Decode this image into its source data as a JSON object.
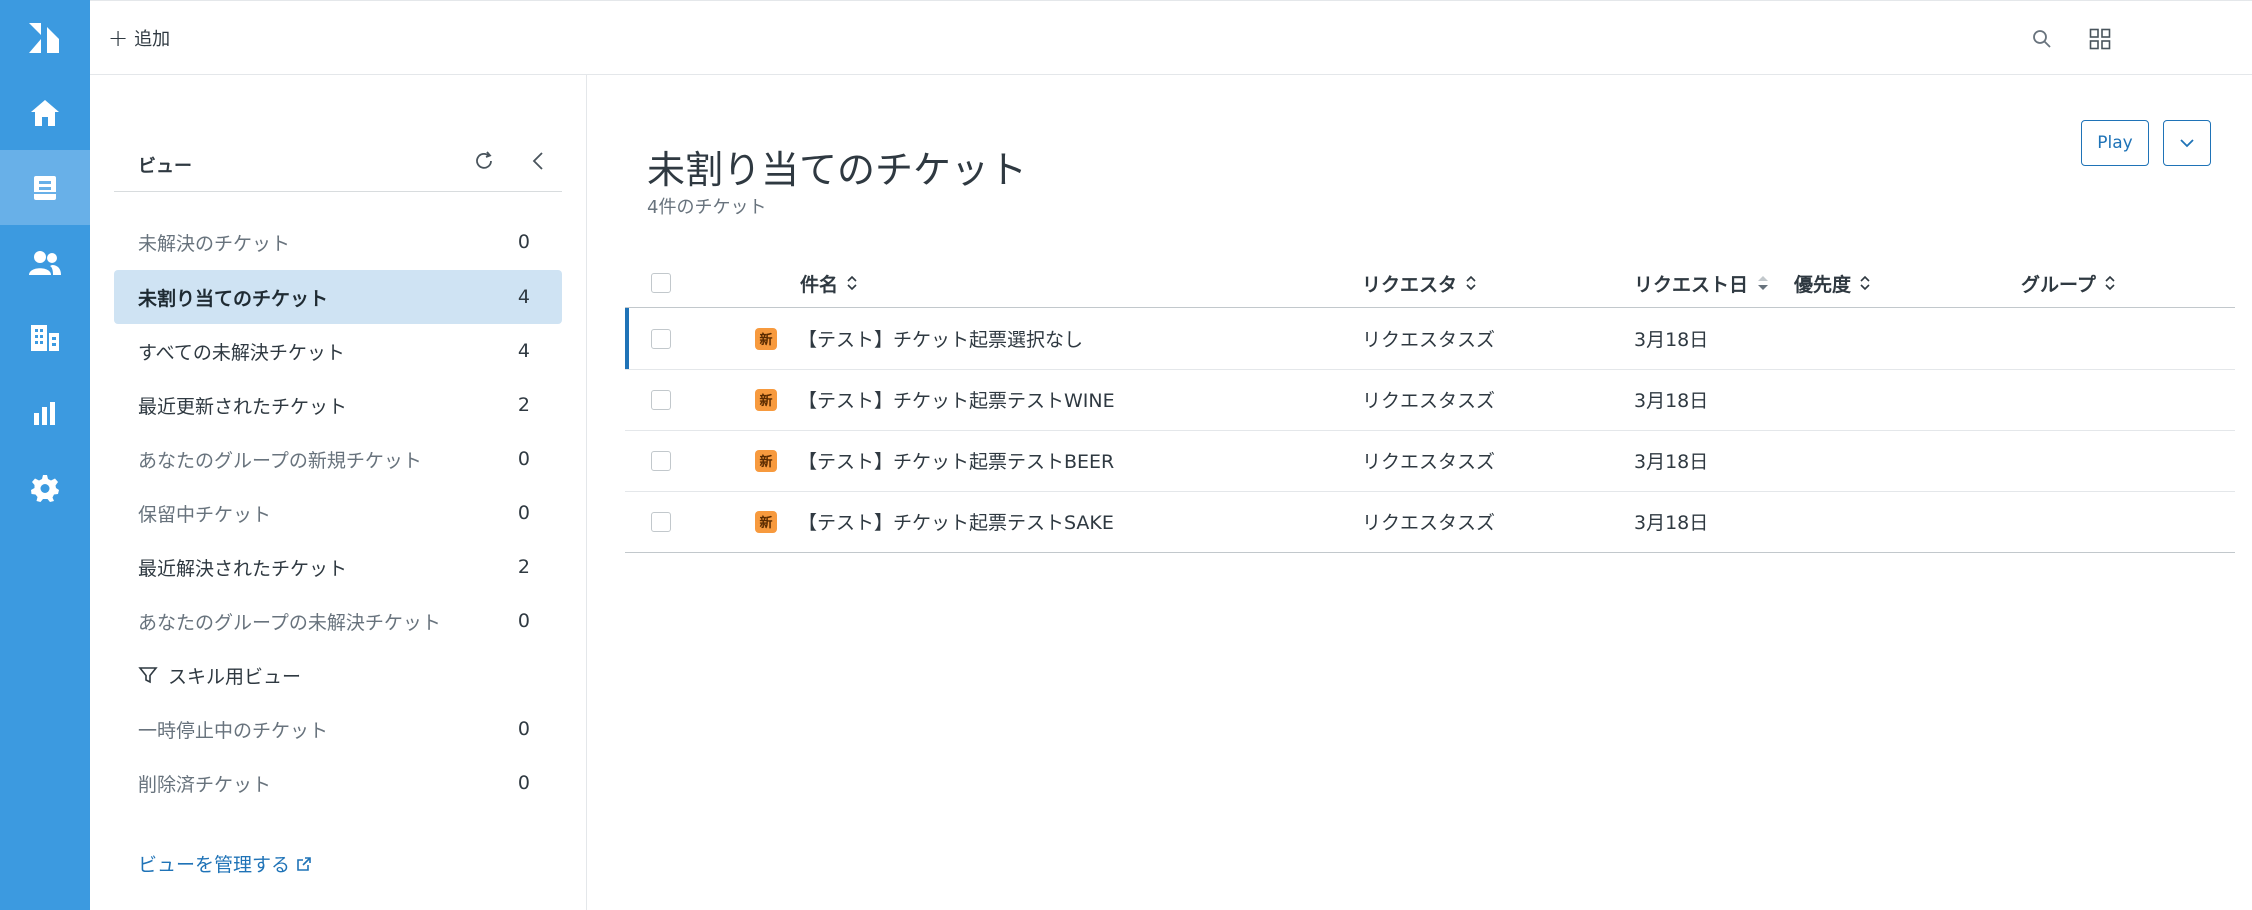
{
  "header": {
    "add_label": "追加"
  },
  "views": {
    "title": "ビュー",
    "items": [
      {
        "label": "未解決のチケット",
        "count": "0"
      },
      {
        "label": "未割り当てのチケット",
        "count": "4"
      },
      {
        "label": "すべての未解決チケット",
        "count": "4"
      },
      {
        "label": "最近更新されたチケット",
        "count": "2"
      },
      {
        "label": "あなたのグループの新規チケット",
        "count": "0"
      },
      {
        "label": "保留中チケット",
        "count": "0"
      },
      {
        "label": "最近解決されたチケット",
        "count": "2"
      },
      {
        "label": "あなたのグループの未解決チケット",
        "count": "0"
      }
    ],
    "group_label": "スキル用ビュー",
    "extra_items": [
      {
        "label": "一時停止中のチケット",
        "count": "0"
      },
      {
        "label": "削除済チケット",
        "count": "0"
      }
    ],
    "manage_label": "ビューを管理する"
  },
  "main": {
    "title": "未割り当てのチケット",
    "subtitle": "4件のチケット",
    "play_label": "Play",
    "columns": {
      "subject": "件名",
      "requester": "リクエスタ",
      "requested": "リクエスト日",
      "priority": "優先度",
      "group": "グループ"
    },
    "rows": [
      {
        "badge": "新",
        "subject": "【テスト】チケット起票選択なし",
        "requester": "リクエスタスズ",
        "requested": "3月18日"
      },
      {
        "badge": "新",
        "subject": "【テスト】チケット起票テストWINE",
        "requester": "リクエスタスズ",
        "requested": "3月18日"
      },
      {
        "badge": "新",
        "subject": "【テスト】チケット起票テストBEER",
        "requester": "リクエスタスズ",
        "requested": "3月18日"
      },
      {
        "badge": "新",
        "subject": "【テスト】チケット起票テストSAKE",
        "requester": "リクエスタスズ",
        "requested": "3月18日"
      }
    ]
  }
}
